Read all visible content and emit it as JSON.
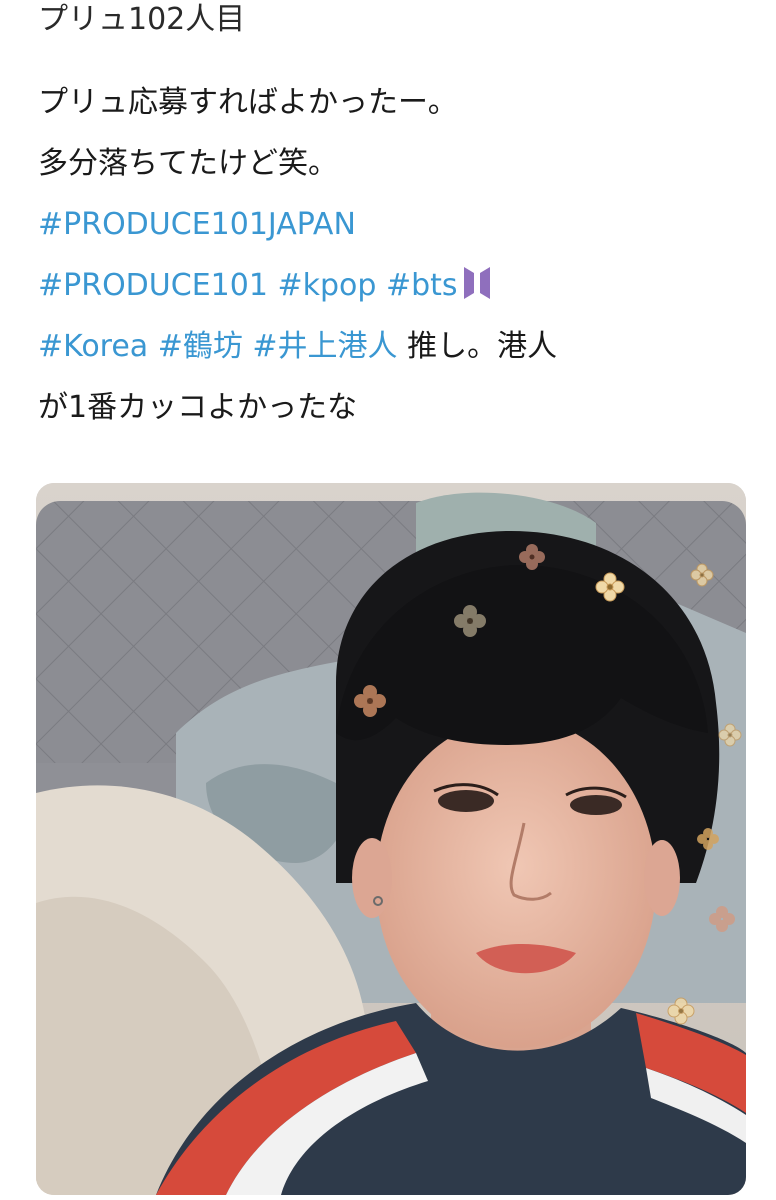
{
  "tweet": {
    "display_name": "プリュ102人目",
    "lines": [
      [
        {
          "text": "プリュ応募すればよかったー。",
          "type": "text"
        }
      ],
      [
        {
          "text": "多分落ちてたけど笑。",
          "type": "text"
        }
      ],
      [
        {
          "text": "#PRODUCE101JAPAN",
          "type": "hashtag"
        }
      ],
      [
        {
          "text": "#PRODUCE101",
          "type": "hashtag"
        },
        {
          "text": " ",
          "type": "text"
        },
        {
          "text": "#kpop",
          "type": "hashtag"
        },
        {
          "text": " ",
          "type": "text"
        },
        {
          "text": "#bts",
          "type": "hashtag"
        },
        {
          "text": "bts-logo-icon",
          "type": "icon"
        }
      ],
      [
        {
          "text": "#Korea",
          "type": "hashtag"
        },
        {
          "text": "  ",
          "type": "text"
        },
        {
          "text": "#鶴坊",
          "type": "hashtag"
        },
        {
          "text": " ",
          "type": "text"
        },
        {
          "text": "#井上港人",
          "type": "hashtag"
        },
        {
          "text": " 推し。港人",
          "type": "text"
        }
      ],
      [
        {
          "text": "が1番カッコよかったな",
          "type": "text"
        }
      ]
    ]
  },
  "media": {
    "icon": "selfie-photo",
    "hashtag_color": "#3a97d2",
    "icon_color": "#8f6fbd"
  }
}
